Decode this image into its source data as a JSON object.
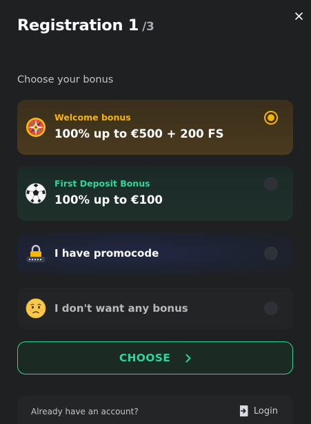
{
  "header": {
    "title": "Registration 1",
    "step_total": "/3",
    "close_icon": "close-icon"
  },
  "section_label": "Choose your bonus",
  "options": [
    {
      "tag": "Welcome bonus",
      "value": "100% up to €500 + 200 FS",
      "icon": "roulette-wheel-icon",
      "selected": true,
      "accent": "#f7b500"
    },
    {
      "tag": "First Deposit Bonus",
      "value": "100% up to €100",
      "icon": "soccer-ball-icon",
      "selected": false,
      "accent": "#2fd59a"
    },
    {
      "value": "I have promocode",
      "icon": "padlock-icon",
      "selected": false
    },
    {
      "value": "I don't want any bonus",
      "icon": "sad-face-icon",
      "selected": false
    }
  ],
  "choose_button": {
    "label": "CHOOSE",
    "icon": "chevron-right-icon",
    "color": "#2fd59a"
  },
  "footer": {
    "question": "Already have an account?",
    "login_label": "Login",
    "login_icon": "login-icon"
  }
}
